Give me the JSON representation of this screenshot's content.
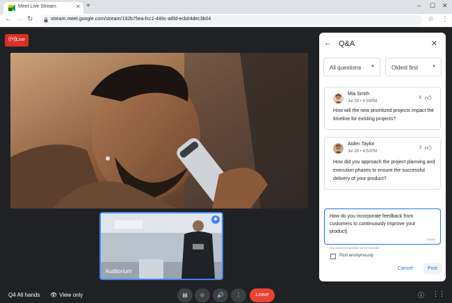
{
  "browser": {
    "tab_title": "Meet Live Stream",
    "tab_close": "✕",
    "new_tab": "+",
    "url": "stream.meet.google.com/stream/192b75ea-fcc1-449c-a6fd-ecb04dec3b04",
    "window_controls": [
      "–",
      "☐",
      "✕"
    ]
  },
  "stage": {
    "live_label": "Live",
    "pip_label": "Auditorium"
  },
  "bottom_bar": {
    "meeting_name": "Q4 All hands",
    "view_only_label": "View only",
    "leave_label": "Leave",
    "controls": [
      "captions-icon",
      "emoji-icon",
      "volume-icon",
      "more-vert-icon"
    ],
    "corner_icons": [
      "info-icon",
      "apps-grid-icon"
    ]
  },
  "qa": {
    "title": "Q&A",
    "filter_value": "All questions",
    "sort_value": "Oldest first",
    "questions": [
      {
        "author": "Mia Smith",
        "time": "Jul 29 • 4:50PM",
        "upvotes": "8",
        "text": "How will the new prioritized projects impact the timeline for existing projects?"
      },
      {
        "author": "Aiden Taylor",
        "time": "Jul 29 • 4:52PM",
        "upvotes": "3",
        "text": "How did you approach the project planning and execution phases to ensure the successful delivery of your product?"
      }
    ],
    "input_value": "How do you incorporate feedback from customers to continuously improve your product|",
    "char_count": "79/300",
    "helper_text": "Your name and question will be recorded",
    "anonymous_label": "Post anonymously",
    "cancel_label": "Cancel",
    "post_label": "Post"
  },
  "colors": {
    "page_bg": "#202124",
    "live_red": "#d93025",
    "leave_red": "#ea4335",
    "accent_blue": "#1a73e8",
    "pip_border": "#4285f4"
  }
}
